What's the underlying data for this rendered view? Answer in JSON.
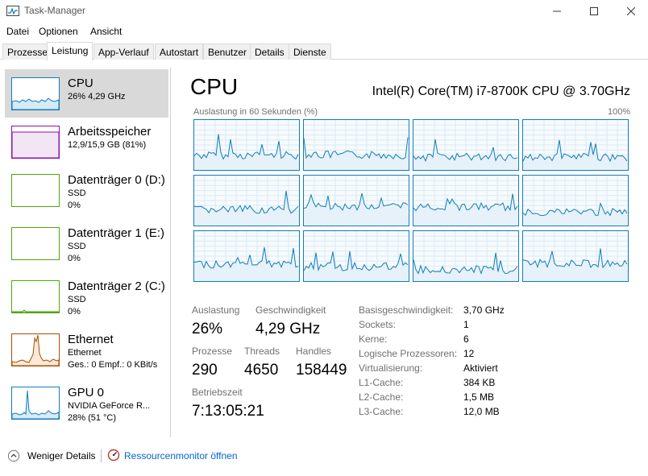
{
  "window": {
    "title": "Task-Manager"
  },
  "menu": [
    "Datei",
    "Optionen",
    "Ansicht"
  ],
  "tabs": [
    "Prozesse",
    "Leistung",
    "App-Verlauf",
    "Autostart",
    "Benutzer",
    "Details",
    "Dienste"
  ],
  "active_tab": "Leistung",
  "sidebar": [
    {
      "title": "CPU",
      "line1": "26% 4,29 GHz",
      "line2": "",
      "color": "#117dbb",
      "selected": true
    },
    {
      "title": "Arbeitsspeicher",
      "line1": "12,9/15,9 GB (81%)",
      "line2": "",
      "color": "#8b12ae",
      "selected": false
    },
    {
      "title": "Datenträger 0 (D:)",
      "line1": "SSD",
      "line2": "0%",
      "color": "#4da60c",
      "selected": false
    },
    {
      "title": "Datenträger 1 (E:)",
      "line1": "SSD",
      "line2": "0%",
      "color": "#4da60c",
      "selected": false
    },
    {
      "title": "Datenträger 2 (C:)",
      "line1": "SSD",
      "line2": "0%",
      "color": "#4da60c",
      "selected": false
    },
    {
      "title": "Ethernet",
      "line1": "Ethernet",
      "line2": "Ges.: 0 Empf.: 0 KBit/s",
      "color": "#a74f01",
      "selected": false
    },
    {
      "title": "GPU 0",
      "line1": "NVIDIA GeForce R...",
      "line2": "28% (51 °C)",
      "color": "#117dbb",
      "selected": false
    }
  ],
  "main": {
    "title": "CPU",
    "model": "Intel(R) Core(TM) i7-8700K CPU @ 3.70GHz",
    "graph_caption": "Auslastung in 60 Sekunden (%)",
    "graph_max": "100%",
    "core_count": 12,
    "stats": {
      "auslastung_label": "Auslastung",
      "auslastung_value": "26%",
      "geschwindigkeit_label": "Geschwindigkeit",
      "geschwindigkeit_value": "4,29 GHz",
      "prozesse_label": "Prozesse",
      "prozesse_value": "290",
      "threads_label": "Threads",
      "threads_value": "4650",
      "handles_label": "Handles",
      "handles_value": "158449",
      "betriebszeit_label": "Betriebszeit",
      "betriebszeit_value": "7:13:05:21"
    },
    "details": [
      {
        "label": "Basisgeschwindigkeit:",
        "value": "3,70 GHz"
      },
      {
        "label": "Sockets:",
        "value": "1"
      },
      {
        "label": "Kerne:",
        "value": "6"
      },
      {
        "label": "Logische Prozessoren:",
        "value": "12"
      },
      {
        "label": "Virtualisierung:",
        "value": "Aktiviert"
      },
      {
        "label": "L1-Cache:",
        "value": "384 KB"
      },
      {
        "label": "L2-Cache:",
        "value": "1,5 MB"
      },
      {
        "label": "L3-Cache:",
        "value": "12,0 MB"
      }
    ]
  },
  "footer": {
    "fewer_details": "Weniger Details",
    "resource_monitor": "Ressourcenmonitor öffnen"
  },
  "colors": {
    "cpu": "#117dbb",
    "memory": "#8b12ae",
    "disk": "#4da60c",
    "ethernet": "#a74f01",
    "link": "#0066cc"
  }
}
